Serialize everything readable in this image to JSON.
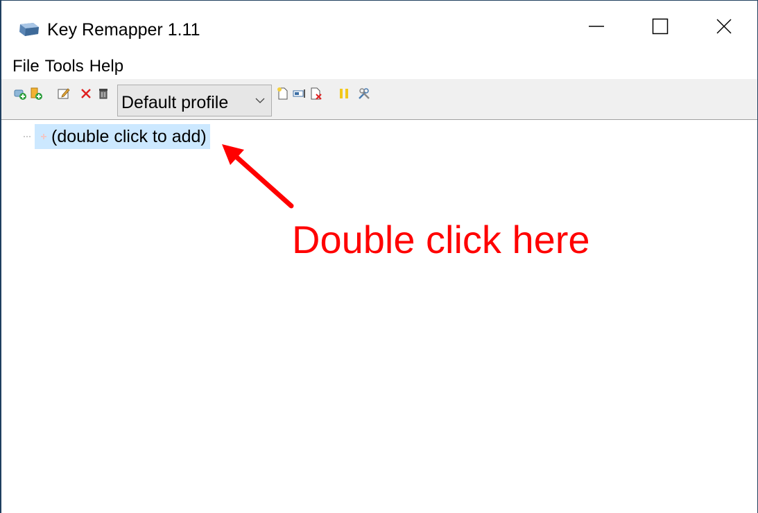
{
  "window": {
    "title": "Key Remapper 1.11",
    "controls": {
      "minimize": "minimize-icon",
      "maximize": "maximize-icon",
      "close": "close-icon"
    }
  },
  "menu": {
    "items": [
      {
        "label": "File"
      },
      {
        "label": "Tools"
      },
      {
        "label": "Help"
      }
    ]
  },
  "toolbar": {
    "profile_select": {
      "value": "Default profile"
    },
    "buttons": [
      "add-group-icon",
      "add-item-icon",
      "edit-icon",
      "delete-icon",
      "clear-icon",
      "new-profile-icon",
      "rename-profile-icon",
      "delete-profile-icon",
      "pause-icon",
      "settings-icon"
    ]
  },
  "tree": {
    "items": [
      {
        "label": "(double click to add)"
      }
    ]
  },
  "annotation": {
    "text": "Double click here",
    "color": "#ff0000"
  },
  "colors": {
    "selection": "#cce8ff",
    "toolbar_bg": "#f0f0f0",
    "border": "#1f3f5f"
  }
}
